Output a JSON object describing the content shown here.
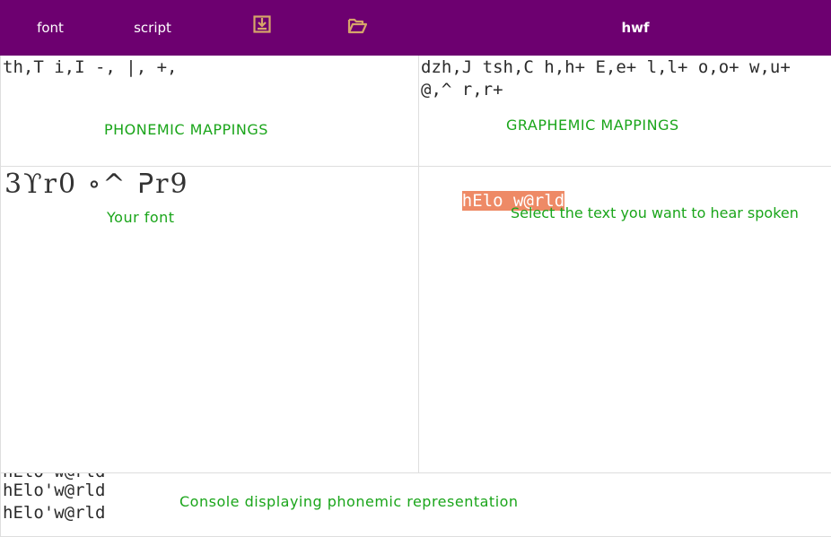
{
  "toolbar": {
    "font_label": "font",
    "script_label": "script",
    "save_icon": "save-icon",
    "open_icon": "folder-open-icon",
    "title": "hwf",
    "accent": "#6d0070",
    "icon_color": "#d6a56a"
  },
  "phonemic": {
    "text": "th,T i,I -, |, +,",
    "hint": "PHONEMIC MAPPINGS"
  },
  "graphemic": {
    "text": "dzh,J tsh,C h,h+ E,e+ l,l+ o,o+ w,u+ @,^ r,r+",
    "hint": "GRAPHEMIC MAPPINGS"
  },
  "font_pane": {
    "glyphs": "3ϒr0 ∘^ ᕈr9",
    "hint": "Your font"
  },
  "text_pane": {
    "text": "hElo w@rld",
    "hint": "Select the text you want to hear spoken",
    "selection_color": "#ee8a66"
  },
  "console": {
    "partial_line": "hElo w@rld",
    "lines": [
      "hElo'w@rld",
      "hElo'w@rld"
    ],
    "hint": "Console displaying phonemic representation"
  }
}
